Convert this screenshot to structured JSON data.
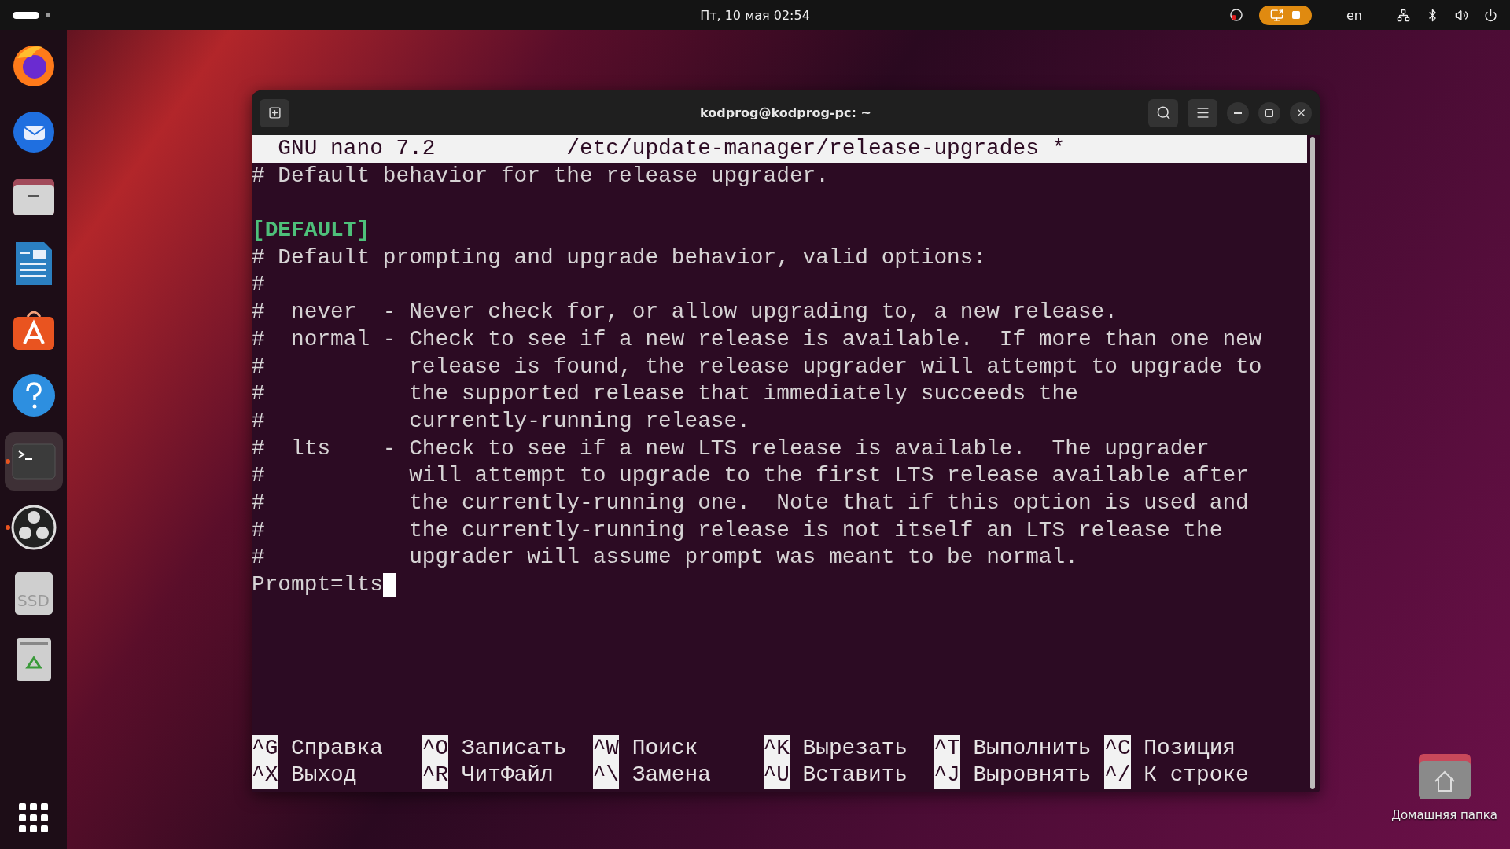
{
  "top_bar": {
    "clock": "Пт, 10 мая  02:54",
    "keyboard": "en",
    "recording": true
  },
  "dock": {
    "items": [
      {
        "kind": "firefox",
        "running": false,
        "selected": false
      },
      {
        "kind": "thunderbird",
        "running": false,
        "selected": false
      },
      {
        "kind": "files",
        "running": false,
        "selected": false
      },
      {
        "kind": "writer",
        "running": false,
        "selected": false
      },
      {
        "kind": "appstore",
        "running": false,
        "selected": false
      },
      {
        "kind": "help",
        "running": false,
        "selected": false
      },
      {
        "kind": "terminal",
        "running": true,
        "selected": true
      },
      {
        "kind": "obs",
        "running": true,
        "selected": false
      },
      {
        "kind": "drive",
        "label": "SSD",
        "running": false,
        "selected": false
      },
      {
        "kind": "trash",
        "running": false,
        "selected": false
      }
    ]
  },
  "window": {
    "title": "kodprog@kodprog-pc: ~",
    "nano": {
      "version": "GNU nano 7.2",
      "file": "/etc/update-manager/release-upgrades *",
      "lines": [
        {
          "kind": "comment",
          "text": "# Default behavior for the release upgrader."
        },
        {
          "kind": "blank"
        },
        {
          "kind": "section",
          "text": "[DEFAULT]"
        },
        {
          "kind": "comment",
          "text": "# Default prompting and upgrade behavior, valid options:"
        },
        {
          "kind": "comment",
          "text": "#"
        },
        {
          "kind": "comment",
          "text": "#  never  - Never check for, or allow upgrading to, a new release."
        },
        {
          "kind": "comment",
          "text": "#  normal - Check to see if a new release is available.  If more than one new"
        },
        {
          "kind": "comment",
          "text": "#           release is found, the release upgrader will attempt to upgrade to"
        },
        {
          "kind": "comment",
          "text": "#           the supported release that immediately succeeds the"
        },
        {
          "kind": "comment",
          "text": "#           currently-running release."
        },
        {
          "kind": "comment",
          "text": "#  lts    - Check to see if a new LTS release is available.  The upgrader"
        },
        {
          "kind": "comment",
          "text": "#           will attempt to upgrade to the first LTS release available after"
        },
        {
          "kind": "comment",
          "text": "#           the currently-running one.  Note that if this option is used and"
        },
        {
          "kind": "comment",
          "text": "#           the currently-running release is not itself an LTS release the"
        },
        {
          "kind": "comment",
          "text": "#           upgrader will assume prompt was meant to be normal."
        },
        {
          "kind": "code",
          "text": "Prompt=lts",
          "cursor": true
        }
      ],
      "shortcuts": [
        {
          "key": "^G",
          "label": "Справка"
        },
        {
          "key": "^O",
          "label": "Записать"
        },
        {
          "key": "^W",
          "label": "Поиск"
        },
        {
          "key": "^K",
          "label": "Вырезать"
        },
        {
          "key": "^T",
          "label": "Выполнить"
        },
        {
          "key": "^C",
          "label": "Позиция"
        },
        {
          "key": "^X",
          "label": "Выход"
        },
        {
          "key": "^R",
          "label": "ЧитФайл"
        },
        {
          "key": "^\\",
          "label": "Замена"
        },
        {
          "key": "^U",
          "label": "Вставить"
        },
        {
          "key": "^J",
          "label": "Выровнять"
        },
        {
          "key": "^/",
          "label": "К строке"
        }
      ]
    }
  },
  "desktop": {
    "icons": [
      {
        "label": "Домашняя папка"
      }
    ]
  }
}
